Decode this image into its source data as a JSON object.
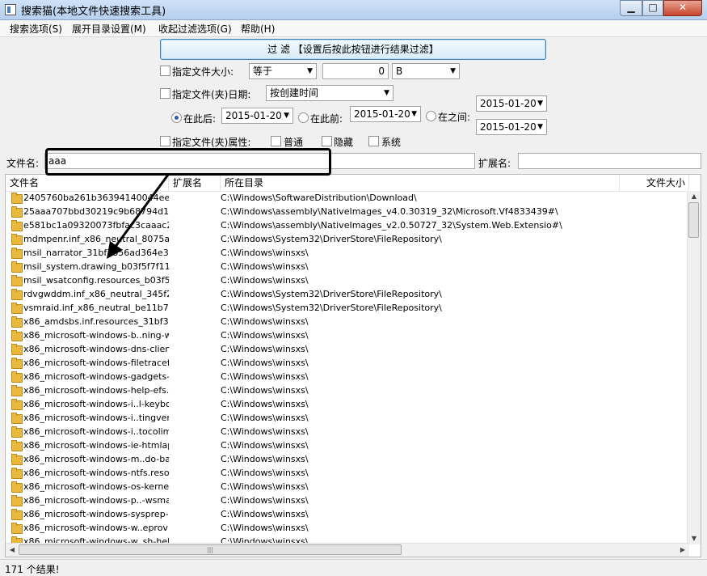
{
  "window": {
    "title": "搜索猫(本地文件快速搜索工具)",
    "minimize": "▁",
    "maximize": "□",
    "close": "✕"
  },
  "menu": [
    "搜索选项(S)",
    "展开目录设置(M)",
    "收起过滤选项(G)",
    "帮助(H)"
  ],
  "filter": {
    "button_label": "过 滤 【设置后按此按钮进行结果过滤】",
    "size_label": "指定文件大小:",
    "size_op": "等于",
    "size_value": "0",
    "size_unit": "B",
    "date_label": "指定文件(夹)日期:",
    "date_type": "按创建时间",
    "after_label": "在此后:",
    "after_date": "2015-01-20",
    "before_label": "在此前:",
    "before_date": "2015-01-20",
    "between_label": "在之间:",
    "between_start": "2015-01-20",
    "between_end": "2015-01-20",
    "attr_label": "指定文件(夹)属性:",
    "attr_normal": "普通",
    "attr_hidden": "隐藏",
    "attr_system": "系统",
    "filename_label": "文件名:",
    "filename_value": "aaa",
    "ext_label": "扩展名:",
    "ext_value": ""
  },
  "columns": {
    "name": "文件名",
    "ext": "扩展名",
    "dir": "所在目录",
    "size": "文件大小"
  },
  "rows": [
    {
      "name": "2405760ba261b36394140044ee...",
      "path": "C:\\Windows\\SoftwareDistribution\\Download\\"
    },
    {
      "name": "25aaa707bbd30219c9b68794d1...",
      "path": "C:\\Windows\\assembly\\NativeImages_v4.0.30319_32\\Microsoft.Vf4833439#\\"
    },
    {
      "name": "e581bc1a09320073fbfac3caaac2...",
      "path": "C:\\Windows\\assembly\\NativeImages_v2.0.50727_32\\System.Web.Extensio#\\"
    },
    {
      "name": "mdmpenr.inf_x86_neutral_8075a...",
      "path": "C:\\Windows\\System32\\DriverStore\\FileRepository\\"
    },
    {
      "name": "msil_narrator_31bf3856ad364e35...",
      "path": "C:\\Windows\\winsxs\\"
    },
    {
      "name": "msil_system.drawing_b03f5f7f11...",
      "path": "C:\\Windows\\winsxs\\"
    },
    {
      "name": "msil_wsatconfig.resources_b03f5f...",
      "path": "C:\\Windows\\winsxs\\"
    },
    {
      "name": "rdvgwddm.inf_x86_neutral_345f2...",
      "path": "C:\\Windows\\System32\\DriverStore\\FileRepository\\"
    },
    {
      "name": "vsmraid.inf_x86_neutral_be11b7...",
      "path": "C:\\Windows\\System32\\DriverStore\\FileRepository\\"
    },
    {
      "name": "x86_amdsbs.inf.resources_31bf3...",
      "path": "C:\\Windows\\winsxs\\"
    },
    {
      "name": "x86_microsoft-windows-b..ning-w...",
      "path": "C:\\Windows\\winsxs\\"
    },
    {
      "name": "x86_microsoft-windows-dns-client...",
      "path": "C:\\Windows\\winsxs\\"
    },
    {
      "name": "x86_microsoft-windows-filetracefil...",
      "path": "C:\\Windows\\winsxs\\"
    },
    {
      "name": "x86_microsoft-windows-gadgets-...",
      "path": "C:\\Windows\\winsxs\\"
    },
    {
      "name": "x86_microsoft-windows-help-efs.r...",
      "path": "C:\\Windows\\winsxs\\"
    },
    {
      "name": "x86_microsoft-windows-i..l-keybo...",
      "path": "C:\\Windows\\winsxs\\"
    },
    {
      "name": "x86_microsoft-windows-i..tingver...",
      "path": "C:\\Windows\\winsxs\\"
    },
    {
      "name": "x86_microsoft-windows-i..tocolim...",
      "path": "C:\\Windows\\winsxs\\"
    },
    {
      "name": "x86_microsoft-windows-ie-htmlap...",
      "path": "C:\\Windows\\winsxs\\"
    },
    {
      "name": "x86_microsoft-windows-m..do-ba...",
      "path": "C:\\Windows\\winsxs\\"
    },
    {
      "name": "x86_microsoft-windows-ntfs.reso...",
      "path": "C:\\Windows\\winsxs\\"
    },
    {
      "name": "x86_microsoft-windows-os-kernel...",
      "path": "C:\\Windows\\winsxs\\"
    },
    {
      "name": "x86_microsoft-windows-p..-wsma...",
      "path": "C:\\Windows\\winsxs\\"
    },
    {
      "name": "x86_microsoft-windows-sysprep-s...",
      "path": "C:\\Windows\\winsxs\\"
    },
    {
      "name": "x86_microsoft-windows-w..eprovi...",
      "path": "C:\\Windows\\winsxs\\"
    },
    {
      "name": "x86_microsoft-windows-w..sh-hel...",
      "path": "C:\\Windows\\winsxs\\"
    }
  ],
  "status": "171 个结果!",
  "icons": {
    "app": "app-icon",
    "folder": "folder-icon",
    "dropdown": "chevron-down-icon",
    "scroll_up": "scroll-up-icon",
    "scroll_down": "scroll-down-icon"
  }
}
